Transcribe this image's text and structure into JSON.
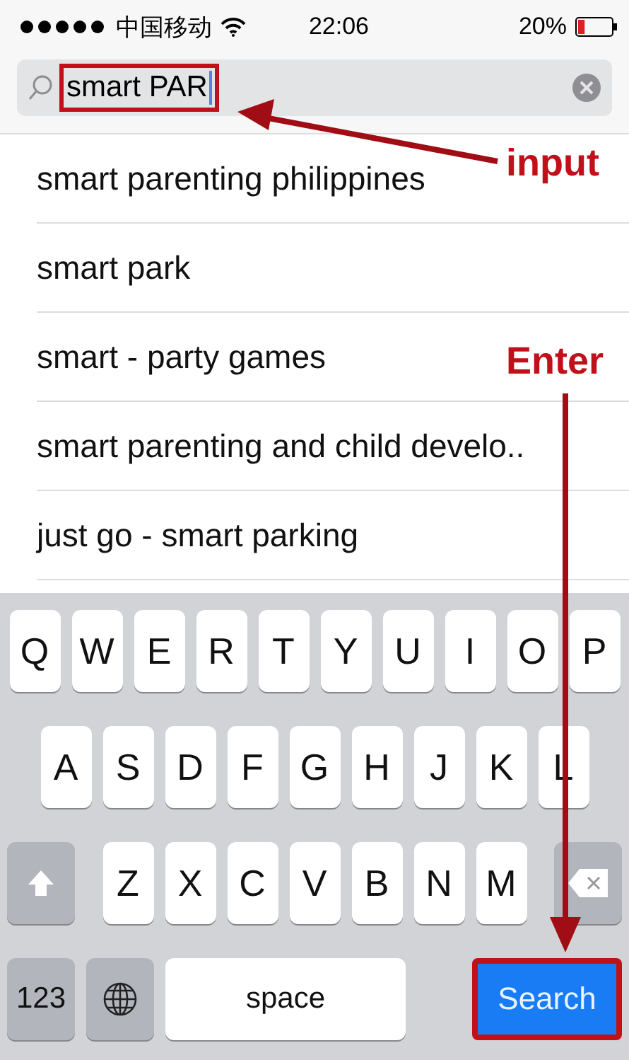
{
  "status_bar": {
    "carrier": "中国移动",
    "time": "22:06",
    "battery": {
      "text": "20%",
      "level": 0.2
    }
  },
  "search": {
    "value": "smart PAR",
    "highlighted": true
  },
  "suggestions": [
    "smart parenting philippines",
    "smart park",
    "smart - party games",
    "smart parenting and child develo..",
    "just go - smart parking"
  ],
  "keyboard": {
    "rows": [
      [
        "Q",
        "W",
        "E",
        "R",
        "T",
        "Y",
        "U",
        "I",
        "O",
        "P"
      ],
      [
        "A",
        "S",
        "D",
        "F",
        "G",
        "H",
        "J",
        "K",
        "L"
      ],
      [
        "Z",
        "X",
        "C",
        "V",
        "B",
        "N",
        "M"
      ]
    ],
    "numbers_key": "123",
    "space_key": "space",
    "search_key": {
      "label": "Search",
      "highlighted": true
    }
  },
  "annotations": [
    {
      "kind": "input",
      "label": "input"
    },
    {
      "kind": "enter",
      "label": "Enter"
    }
  ]
}
